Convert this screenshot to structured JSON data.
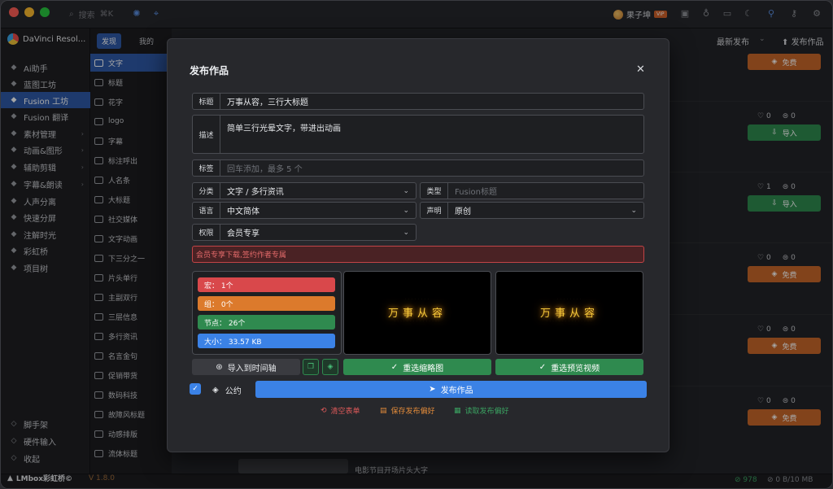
{
  "titlebar": {
    "search_placeholder": "搜索",
    "search_shortcut": "⌘K",
    "user_name": "果子坤",
    "user_badge": "VIP"
  },
  "sidebar": {
    "app_name": "DaVinci Resol...",
    "items": [
      {
        "label": "Ai助手",
        "icon": "ai-icon"
      },
      {
        "label": "蓝图工坊",
        "icon": "blueprint-icon"
      },
      {
        "label": "Fusion 工坊",
        "icon": "fusion-icon",
        "active": true
      },
      {
        "label": "Fusion 翻译",
        "icon": "translate-icon"
      },
      {
        "label": "素材管理",
        "icon": "assets-icon",
        "expand": true
      },
      {
        "label": "动画&图形",
        "icon": "animation-icon",
        "expand": true
      },
      {
        "label": "辅助剪辑",
        "icon": "edit-icon",
        "expand": true
      },
      {
        "label": "字幕&朗读",
        "icon": "subtitle-icon",
        "expand": true
      },
      {
        "label": "人声分离",
        "icon": "voice-icon"
      },
      {
        "label": "快速分屏",
        "icon": "split-icon"
      },
      {
        "label": "注解时光",
        "icon": "note-icon"
      },
      {
        "label": "彩虹桥",
        "icon": "rainbow-icon"
      },
      {
        "label": "项目树",
        "icon": "tree-icon"
      }
    ],
    "bottom_items": [
      {
        "label": "脚手架",
        "icon": "scaffold-icon"
      },
      {
        "label": "硬件输入",
        "icon": "hardware-icon"
      },
      {
        "label": "收起",
        "icon": "collapse-icon"
      }
    ],
    "brand": "LMbox彩虹桥©",
    "version": "V 1.8.0"
  },
  "tabs": {
    "discover": "发现",
    "mine": "我的"
  },
  "categories": [
    "文字",
    "标题",
    "花字",
    "logo",
    "字幕",
    "标注呼出",
    "人名条",
    "大标题",
    "社交媒体",
    "文字动画",
    "下三分之一",
    "片头单行",
    "主副双行",
    "三层信息",
    "多行资讯",
    "名言金句",
    "促销带货",
    "数码科技",
    "故障风标题",
    "动感排版",
    "流体标题"
  ],
  "content": {
    "sort_label": "最新发布",
    "publish_label": "发布作品",
    "free_label": "免费",
    "import_label": "导入",
    "bottom_card_text": "电影节目开场片头大字",
    "status_count": "978",
    "status_size": "0 B/10 MB",
    "cards": [
      {
        "likes": "0",
        "comments": "0",
        "action": "import"
      },
      {
        "likes": "1",
        "comments": "0",
        "action": "import"
      },
      {
        "likes": "0",
        "comments": "0",
        "action": "free"
      },
      {
        "likes": "0",
        "comments": "0",
        "action": "free"
      },
      {
        "likes": "0",
        "comments": "0",
        "action": "free"
      }
    ]
  },
  "dialog": {
    "title": "发布作品",
    "title_label": "标题",
    "title_value": "万事从容，三行大标题",
    "desc_label": "描述",
    "desc_value": "简单三行光晕文字，带进出动画",
    "tags_label": "标签",
    "tags_placeholder": "回车添加，最多 5 个",
    "category_label": "分类",
    "category_value": "文字 / 多行资讯",
    "type_label": "类型",
    "type_placeholder": "Fusion标题",
    "language_label": "语言",
    "language_value": "中文简体",
    "statement_label": "声明",
    "statement_value": "原创",
    "permission_label": "权限",
    "permission_value": "会员专享",
    "warning": "会员专享下载,签约作者专属",
    "stats": {
      "macro": "宏：  1个",
      "group": "组：  0个",
      "nodes": "节点：  26个",
      "size": "大小：  33.57 KB"
    },
    "stat_colors": {
      "macro": "#d9484b",
      "group": "#dc7a2c",
      "nodes": "#2f8a4f",
      "size": "#3b82e6"
    },
    "preview_text": "万事从容",
    "import_timeline": "导入到时间轴",
    "reselect_thumb": "重选缩略图",
    "reselect_video": "重选预览视频",
    "pact": "公约",
    "publish": "发布作品",
    "clear_form": "清空表单",
    "save_pref": "保存发布偏好",
    "read_pref": "读取发布偏好"
  }
}
